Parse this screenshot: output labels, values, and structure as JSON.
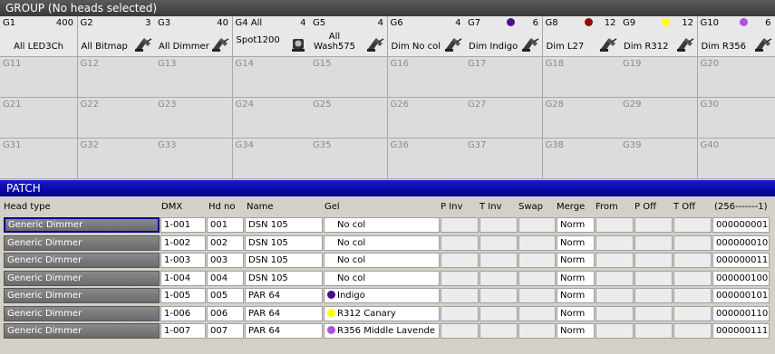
{
  "window": {
    "title": "GROUP (No heads selected)"
  },
  "groups": [
    {
      "id": "G1",
      "count": "400",
      "name": "All LED3Ch",
      "centered": true,
      "dot": null,
      "lamp": false
    },
    {
      "id": "G2",
      "count": "3",
      "name": "All Bitmap",
      "dot": null,
      "lamp": true
    },
    {
      "id": "G3",
      "count": "40",
      "name": "All Dimmer",
      "dot": null,
      "lamp": true
    },
    {
      "id": "G4",
      "count": "4",
      "name": "All Spot1200",
      "nameInline": "G4 All",
      "dot": null,
      "lamp": "head"
    },
    {
      "id": "G5",
      "count": "4",
      "name": "All Wash575",
      "dot": null,
      "lamp": true
    },
    {
      "id": "G6",
      "count": "4",
      "name": "Dim No col",
      "dot": null,
      "lamp": true
    },
    {
      "id": "G7",
      "count": "6",
      "name": "Dim Indigo",
      "dot": "#4b0f8a",
      "lamp": true
    },
    {
      "id": "G8",
      "count": "12",
      "name": "Dim L27",
      "dot": "#8a0c0c",
      "lamp": true
    },
    {
      "id": "G9",
      "count": "12",
      "name": "Dim R312",
      "dot": "#ffff00",
      "lamp": true
    },
    {
      "id": "G10",
      "count": "6",
      "name": "Dim R356",
      "dot": "#b050e0",
      "lamp": true
    }
  ],
  "empty_groups": [
    "G11",
    "G12",
    "G13",
    "G14",
    "G15",
    "G16",
    "G17",
    "G18",
    "G19",
    "G20",
    "G21",
    "G22",
    "G23",
    "G24",
    "G25",
    "G26",
    "G27",
    "G28",
    "G29",
    "G30",
    "G31",
    "G32",
    "G33",
    "G34",
    "G35",
    "G36",
    "G37",
    "G38",
    "G39",
    "G40"
  ],
  "patch": {
    "title": "PATCH",
    "headers": {
      "head_type": "Head type",
      "dmx": "DMX",
      "hd_no": "Hd no",
      "name": "Name",
      "gel": "Gel",
      "p_inv": "P Inv",
      "t_inv": "T Inv",
      "swap": "Swap",
      "merge": "Merge",
      "from": "From",
      "p_off": "P Off",
      "t_off": "T Off",
      "bits": "(256-------1)"
    },
    "rows": [
      {
        "head_type": "Generic Dimmer",
        "dmx": "1-001",
        "hd_no": "001",
        "name": "DSN 105",
        "gel": "No col",
        "gel_color": "#ffffff",
        "merge": "Norm",
        "bits": "000000001"
      },
      {
        "head_type": "Generic Dimmer",
        "dmx": "1-002",
        "hd_no": "002",
        "name": "DSN 105",
        "gel": "No col",
        "gel_color": "#ffffff",
        "merge": "Norm",
        "bits": "000000010"
      },
      {
        "head_type": "Generic Dimmer",
        "dmx": "1-003",
        "hd_no": "003",
        "name": "DSN 105",
        "gel": "No col",
        "gel_color": "#ffffff",
        "merge": "Norm",
        "bits": "000000011"
      },
      {
        "head_type": "Generic Dimmer",
        "dmx": "1-004",
        "hd_no": "004",
        "name": "DSN 105",
        "gel": "No col",
        "gel_color": "#ffffff",
        "merge": "Norm",
        "bits": "000000100"
      },
      {
        "head_type": "Generic Dimmer",
        "dmx": "1-005",
        "hd_no": "005",
        "name": "PAR 64",
        "gel": "Indigo",
        "gel_color": "#4b0f8a",
        "merge": "Norm",
        "bits": "000000101"
      },
      {
        "head_type": "Generic Dimmer",
        "dmx": "1-006",
        "hd_no": "006",
        "name": "PAR 64",
        "gel": "R312 Canary",
        "gel_color": "#ffff00",
        "merge": "Norm",
        "bits": "000000110"
      },
      {
        "head_type": "Generic Dimmer",
        "dmx": "1-007",
        "hd_no": "007",
        "name": "PAR 64",
        "gel": "R356 Middle Lavende",
        "gel_color": "#b050e0",
        "merge": "Norm",
        "bits": "000000111"
      }
    ]
  }
}
